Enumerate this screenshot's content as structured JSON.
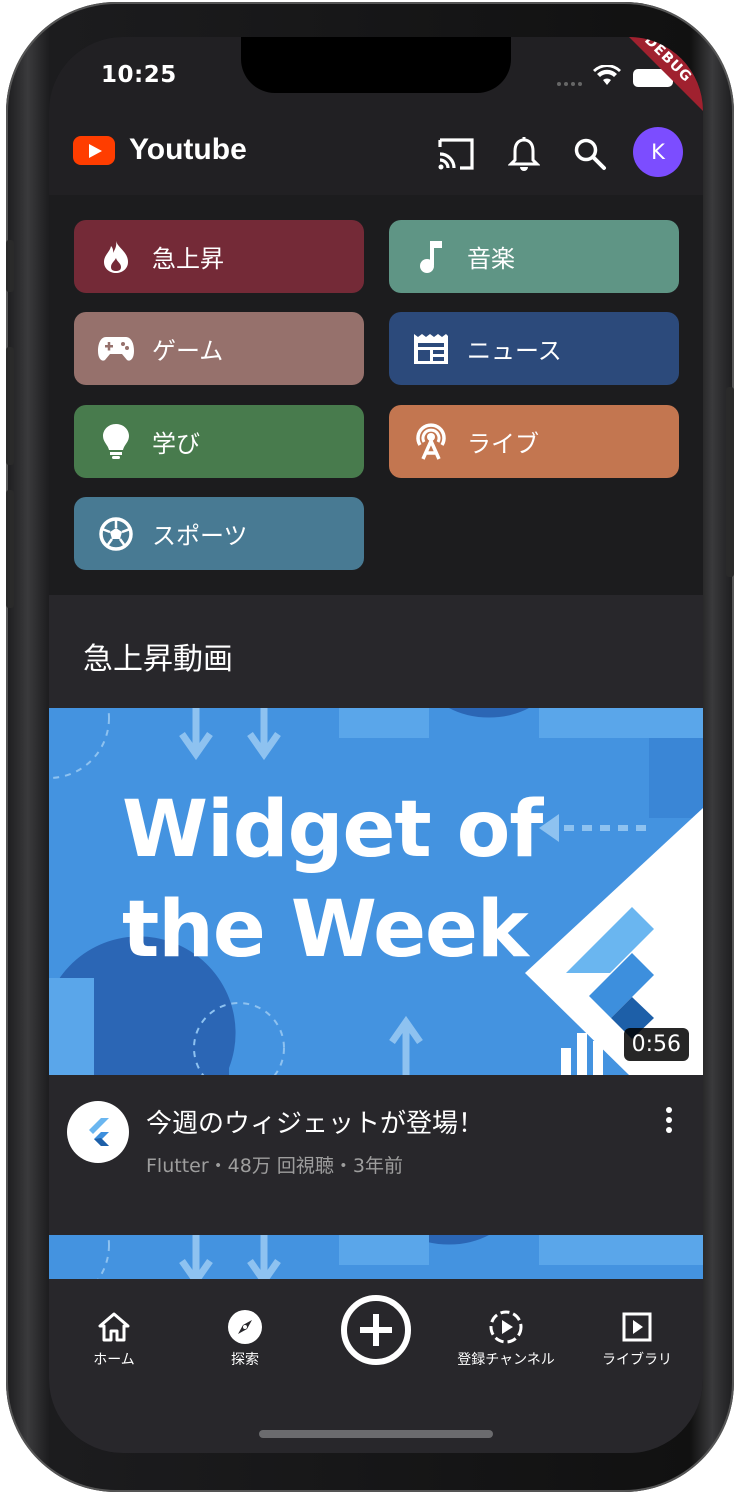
{
  "status_bar": {
    "time": "10:25",
    "debug_banner": "DEBUG"
  },
  "app_bar": {
    "title": "Youtube",
    "avatar_letter": "K",
    "icons": [
      "cast-icon",
      "bell-icon",
      "search-icon"
    ]
  },
  "categories": [
    {
      "label": "急上昇",
      "icon": "fire-icon",
      "color": "#742a37"
    },
    {
      "label": "音楽",
      "icon": "music-note-icon",
      "color": "#5f9585"
    },
    {
      "label": "ゲーム",
      "icon": "gamepad-icon",
      "color": "#96716c"
    },
    {
      "label": "ニュース",
      "icon": "newspaper-icon",
      "color": "#2c4a7b"
    },
    {
      "label": "学び",
      "icon": "lightbulb-icon",
      "color": "#487b4d"
    },
    {
      "label": "ライブ",
      "icon": "live-antenna-icon",
      "color": "#c37650"
    },
    {
      "label": "スポーツ",
      "icon": "soccer-ball-icon",
      "color": "#487a93"
    }
  ],
  "section": {
    "title": "急上昇動画"
  },
  "video": {
    "thumbnail_text": "Widget of the Week",
    "duration": "0:56",
    "title": "今週のウィジェットが登場！",
    "subtitle": "Flutter・48万 回視聴・3年前",
    "channel_logo": "flutter-logo-icon"
  },
  "bottom_nav": {
    "items": [
      {
        "label": "ホーム",
        "icon": "home-icon"
      },
      {
        "label": "探索",
        "icon": "compass-icon"
      },
      {
        "label": "",
        "icon": "add-circle-icon"
      },
      {
        "label": "登録チャンネル",
        "icon": "subscriptions-icon"
      },
      {
        "label": "ライブラリ",
        "icon": "library-icon"
      }
    ]
  },
  "colors": {
    "brand_red": "#ff3d00",
    "avatar_purple": "#7c4dff",
    "thumbnail_blue": "#4493e0"
  }
}
